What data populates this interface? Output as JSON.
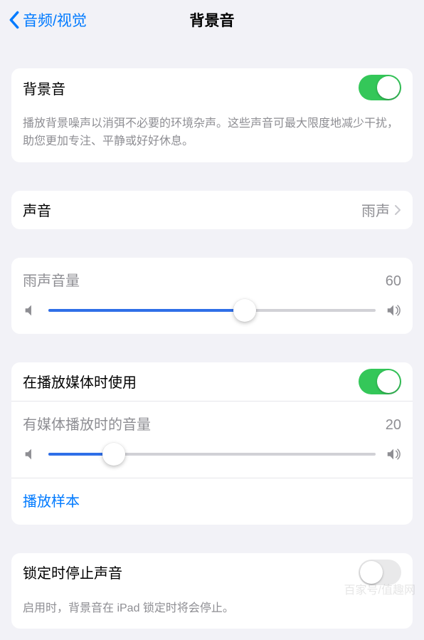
{
  "nav": {
    "back": "音频/视觉",
    "title": "背景音"
  },
  "group1": {
    "toggle_label": "背景音",
    "toggle_on": true,
    "footer": "播放背景噪声以消弭不必要的环境杂声。这些声音可最大限度地减少干扰，助您更加专注、平静或好好休息。"
  },
  "group2": {
    "label": "声音",
    "value": "雨声"
  },
  "group3": {
    "slider_label": "雨声音量",
    "slider_value": "60",
    "slider_pct": 60
  },
  "group4": {
    "toggle_label": "在播放媒体时使用",
    "toggle_on": true,
    "slider_label": "有媒体播放时的音量",
    "slider_value": "20",
    "slider_pct": 20,
    "link": "播放样本"
  },
  "group5": {
    "toggle_label": "锁定时停止声音",
    "toggle_on": false,
    "footer": "启用时，背景音在 iPad 锁定时将会停止。"
  },
  "watermark": "百家号/值趣网"
}
